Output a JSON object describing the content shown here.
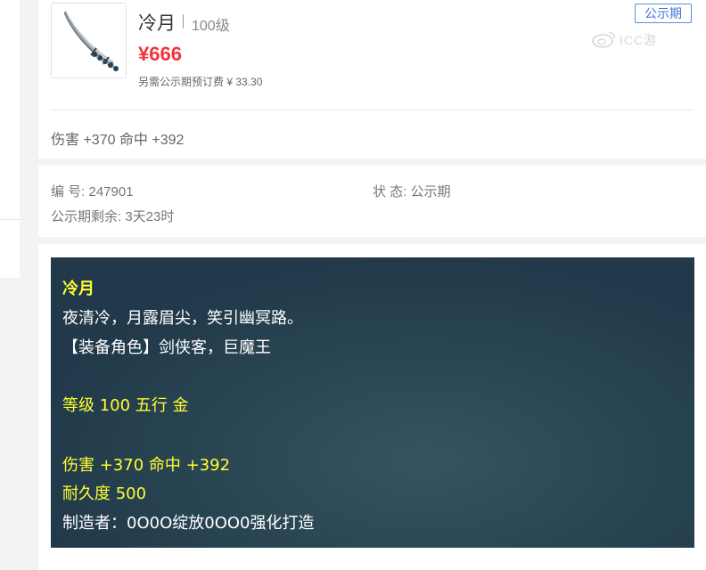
{
  "item": {
    "name": "冷月",
    "level": "100级",
    "price": "¥666",
    "prefee": "另需公示期预订费 ¥ 33.30",
    "status_tag": "公示期",
    "stats": "伤害 +370 命中 +392"
  },
  "watermark": {
    "text": "ICC游"
  },
  "info": {
    "serial": "编 号: 247901",
    "status": "状 态: 公示期",
    "remaining": "公示期剩余: 3天23时"
  },
  "description": {
    "lines": [
      "冷月",
      "夜清冷，月露眉尖，笑引幽冥路。",
      "【装备角色】剑侠客，巨魔王",
      "等级 100 五行 金",
      "伤害 +370 命中 +392",
      "耐久度 500",
      "制造者：0O0O绽放0OO0强化打造"
    ]
  },
  "colors": {
    "price_red": "#f2333b",
    "tag_blue": "#3f76de",
    "desc_yellow": "#ffff33",
    "desc_bg": "#21394a"
  }
}
